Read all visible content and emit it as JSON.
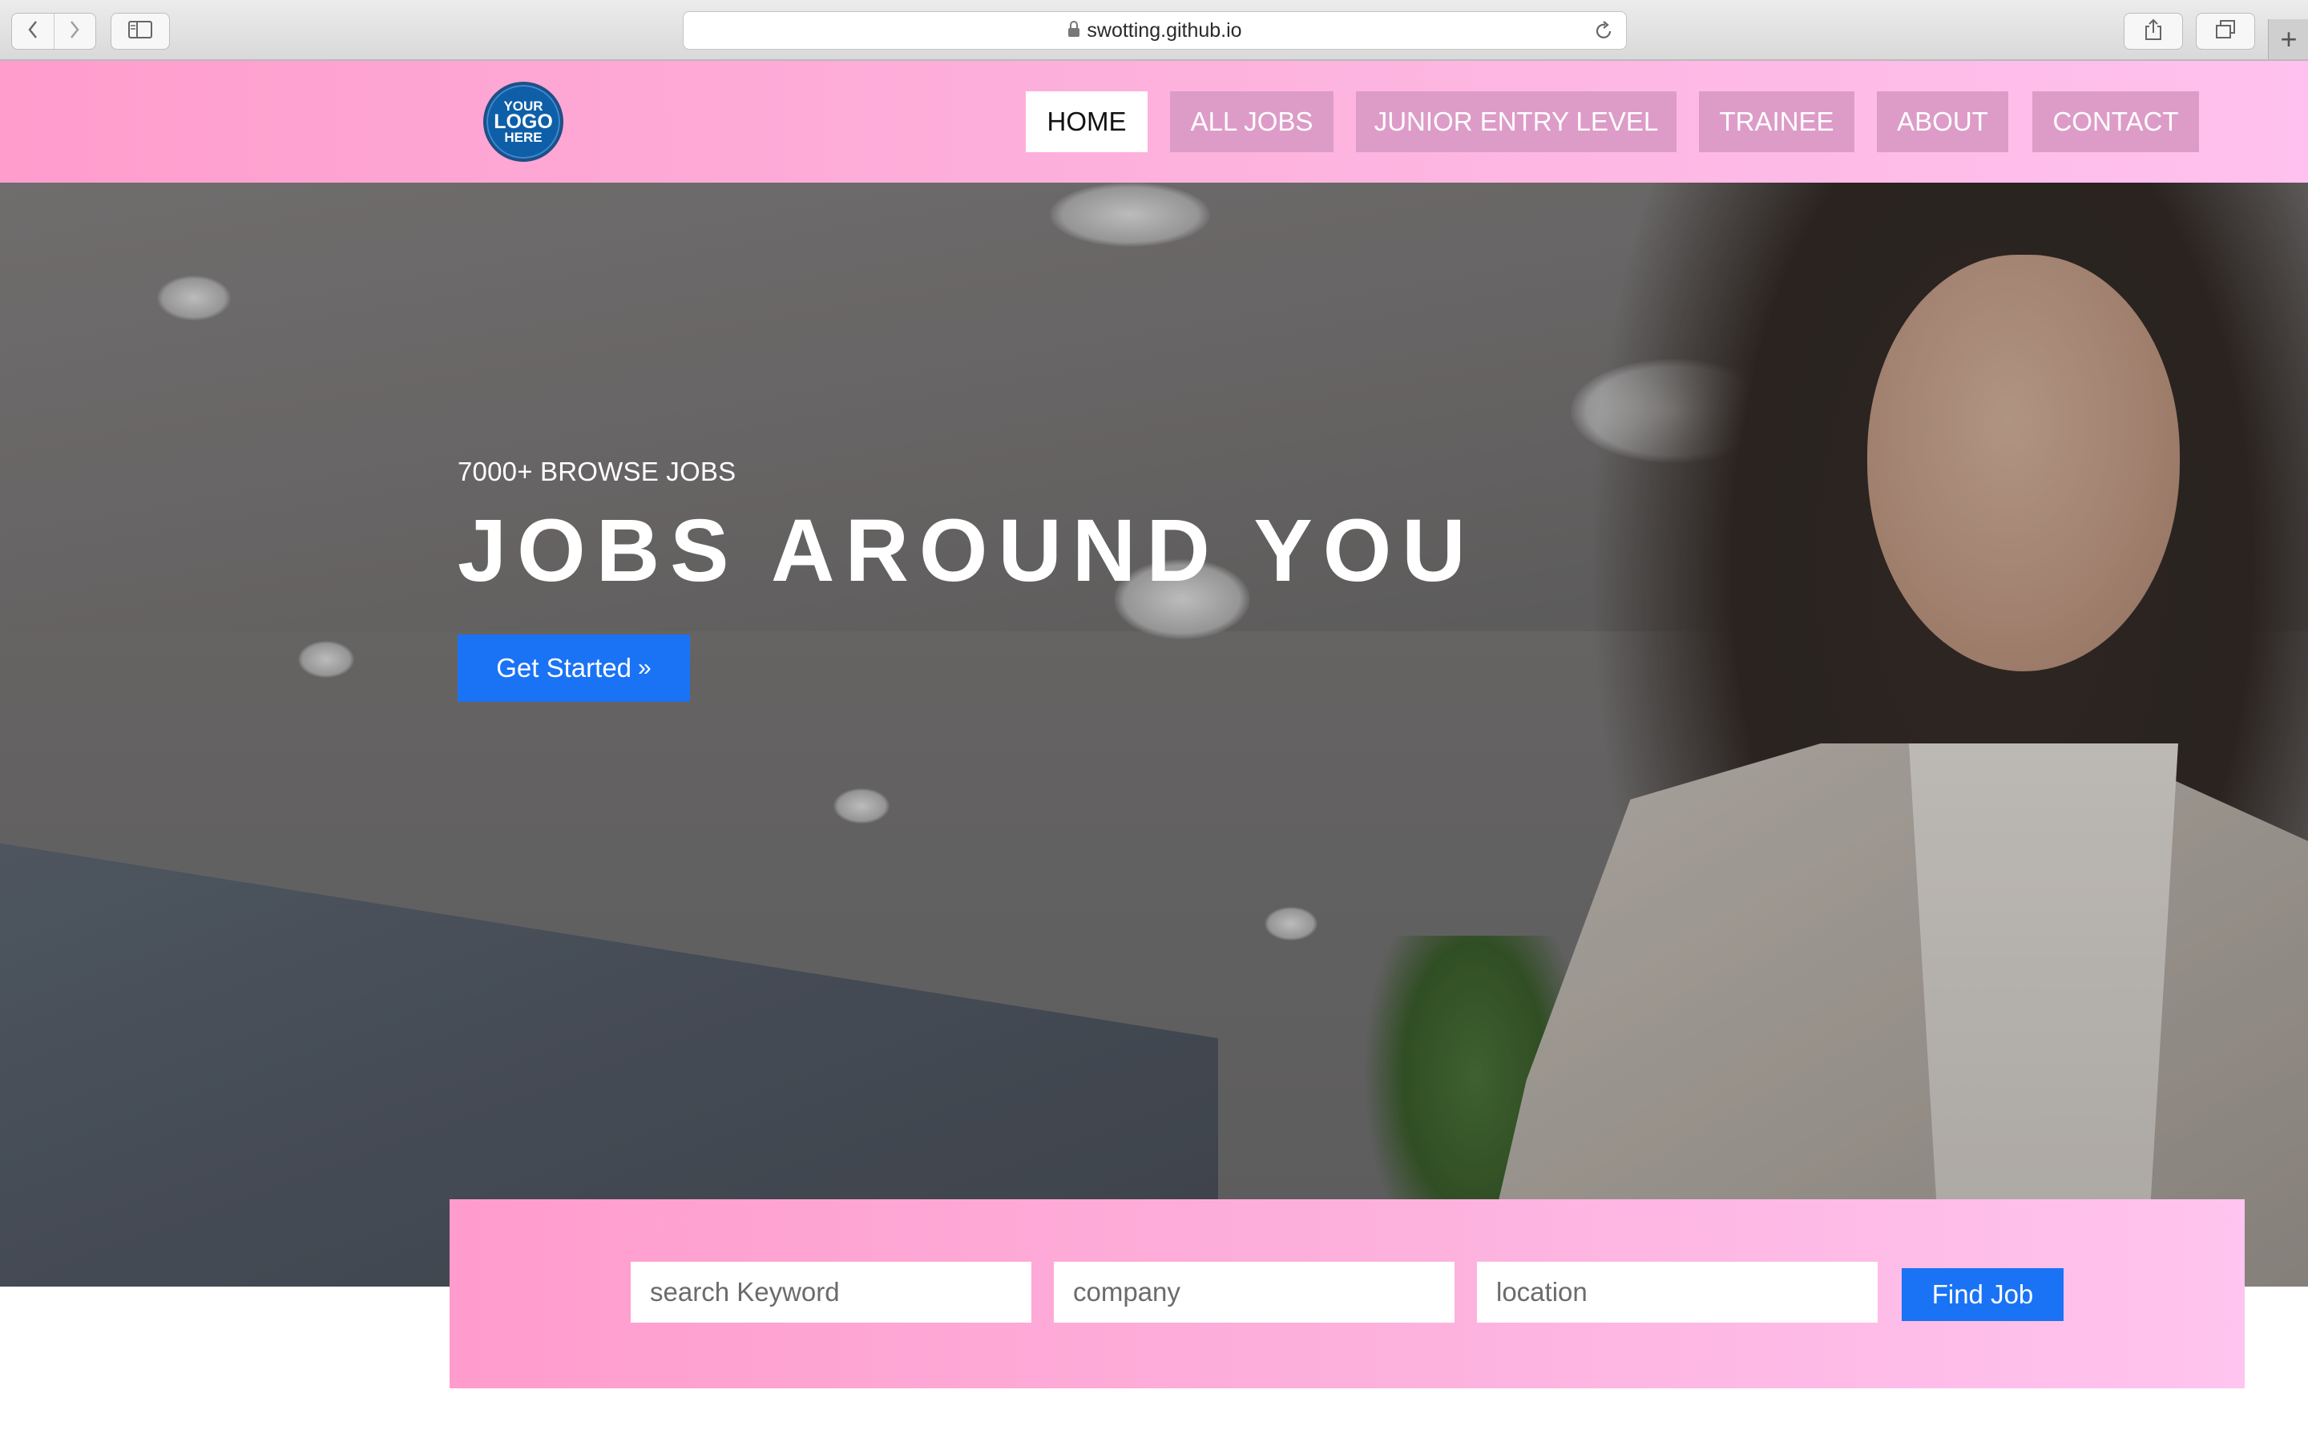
{
  "browser": {
    "url": "swotting.github.io",
    "icons": {
      "back": "chevron-left-icon",
      "forward": "chevron-right-icon",
      "sidebar": "sidebar-icon",
      "lock": "lock-icon",
      "reload": "reload-icon",
      "share": "share-icon",
      "tabs": "tabs-overview-icon",
      "new_tab": "plus-icon"
    },
    "new_tab_glyph": "+"
  },
  "header": {
    "logo": {
      "line1": "YOUR",
      "line2": "LOGO",
      "line3": "HERE"
    },
    "nav": [
      {
        "label": "HOME",
        "active": true
      },
      {
        "label": "ALL JOBS",
        "active": false
      },
      {
        "label": "JUNIOR ENTRY LEVEL",
        "active": false
      },
      {
        "label": "TRAINEE",
        "active": false
      },
      {
        "label": "ABOUT",
        "active": false
      },
      {
        "label": "CONTACT",
        "active": false
      }
    ]
  },
  "hero": {
    "subtitle": "7000+ BROWSE JOBS",
    "title": "JOBS AROUND YOU",
    "cta_label": "Get Started",
    "cta_icon": "double-chevron-right-icon",
    "cta_glyph": "»"
  },
  "search": {
    "keyword_placeholder": "search Keyword",
    "company_placeholder": "company",
    "location_placeholder": "location",
    "keyword_value": "",
    "company_value": "",
    "location_value": "",
    "button_label": "Find Job"
  },
  "colors": {
    "header_gradient_start": "#ff9dcd",
    "header_gradient_end": "#ffc1ef",
    "nav_inactive_bg": "#dd9cc8",
    "nav_active_bg": "#ffffff",
    "button_blue": "#1a73f5",
    "logo_blue": "#0e5fa8"
  }
}
